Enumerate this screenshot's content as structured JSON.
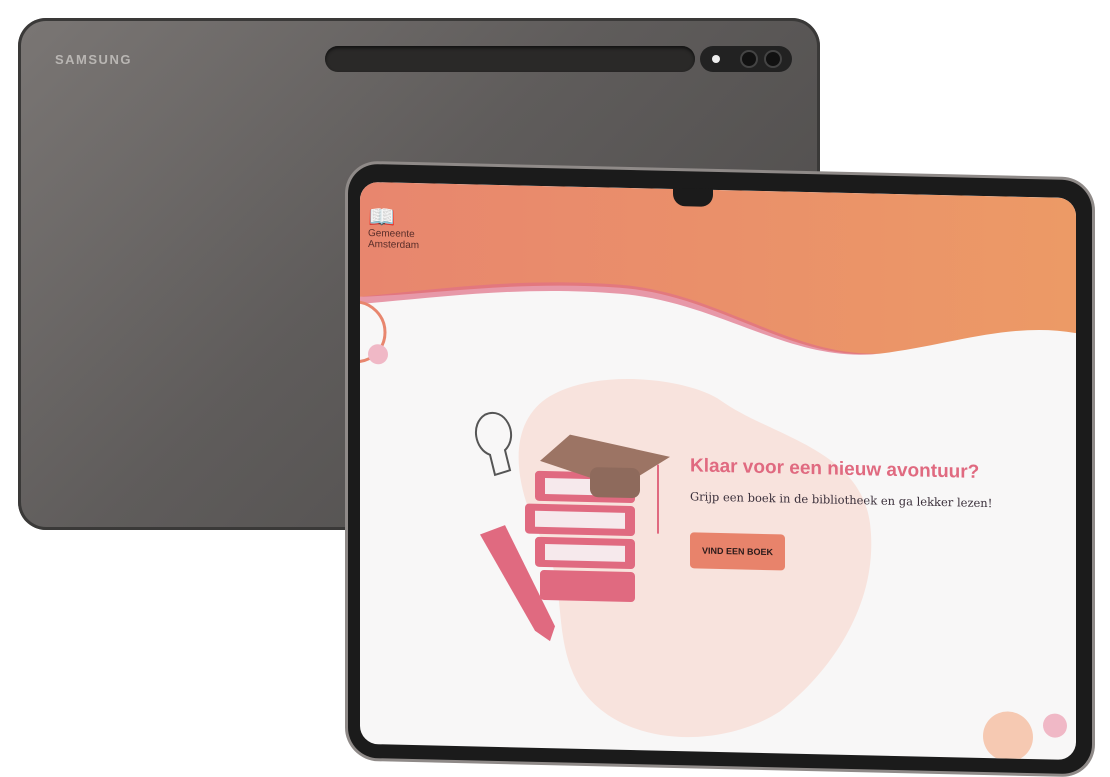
{
  "device_back": {
    "brand": "SAMSUNG"
  },
  "logo": {
    "line1": "Gemeente",
    "line2": "Amsterdam"
  },
  "hero": {
    "title": "Klaar voor een nieuw avontuur?",
    "subtitle": "Grijp een boek in de bibliotheek en ga lekker lezen!",
    "cta_label": "VIND EEN BOEK"
  },
  "colors": {
    "header": "#e8866e",
    "title": "#e06a80",
    "button": "#e8836b",
    "blob": "#f8e3dd"
  }
}
